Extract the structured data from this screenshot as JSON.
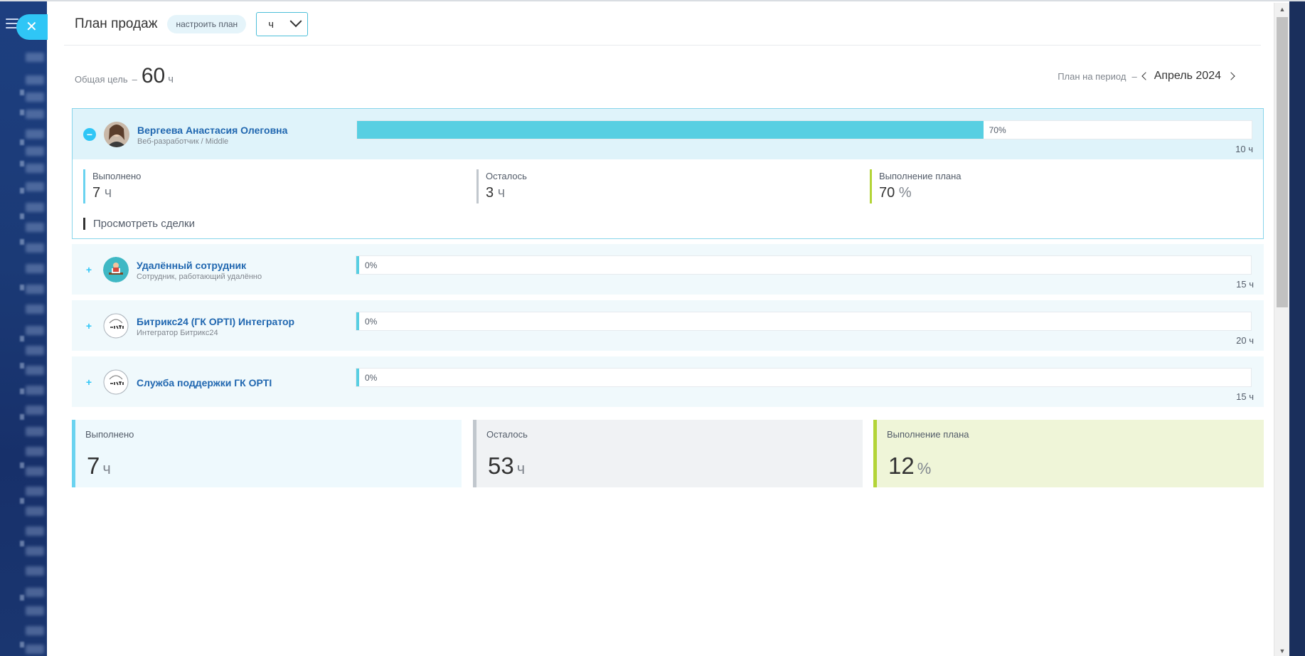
{
  "header": {
    "title": "План продаж",
    "setup_link": "настроить план",
    "unit_select": "ч"
  },
  "goal": {
    "label": "Общая цель",
    "dash": "–",
    "value": "60",
    "unit": "ч"
  },
  "period": {
    "label": "План на период",
    "dash": "–",
    "value": "Апрель 2024"
  },
  "employees": [
    {
      "name": "Вергеева Анастасия Олеговна",
      "role": "Веб-разработчик / Middle",
      "progress": 70,
      "progress_label": "70%",
      "target": "10 ч",
      "expanded": true,
      "stats": {
        "done_label": "Выполнено",
        "done_value": "7",
        "done_unit": "ч",
        "left_label": "Осталось",
        "left_value": "3",
        "left_unit": "ч",
        "plan_label": "Выполнение плана",
        "plan_value": "70",
        "plan_unit": "%"
      },
      "deals_link": "Просмотреть сделки"
    },
    {
      "name": "Удалённый сотрудник",
      "role": "Сотрудник, работающий удалённо",
      "progress": 0,
      "progress_label": "0%",
      "target": "15 ч",
      "expanded": false
    },
    {
      "name": "Битрикс24 (ГК OPTI) Интегратор",
      "role": "Интегратор Битрикс24",
      "progress": 0,
      "progress_label": "0%",
      "target": "20 ч",
      "expanded": false
    },
    {
      "name": "Служба поддержки ГК OPTI",
      "role": "",
      "progress": 0,
      "progress_label": "0%",
      "target": "15 ч",
      "expanded": false
    }
  ],
  "summary": {
    "done_label": "Выполнено",
    "done_value": "7",
    "done_unit": "ч",
    "left_label": "Осталось",
    "left_value": "53",
    "left_unit": "ч",
    "plan_label": "Выполнение плана",
    "plan_value": "12",
    "plan_unit": "%"
  },
  "icons": {
    "close": "✕",
    "expand": "+",
    "collapse": "−"
  },
  "colors": {
    "accent": "#2fc6f6",
    "progress_fill": "#58cfe2",
    "done_stripe": "#6ad3f0",
    "left_stripe": "#c1c7cd",
    "plan_stripe": "#b3d437",
    "done_box": "#eef9fd",
    "left_box": "#f0f2f4",
    "plan_box": "#eff5d8"
  }
}
